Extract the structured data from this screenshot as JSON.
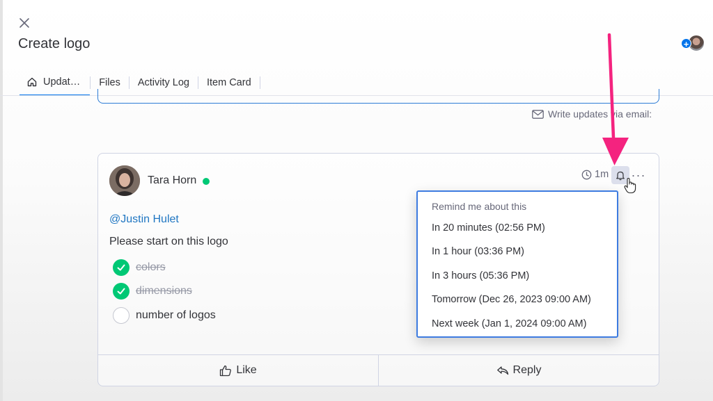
{
  "header": {
    "title": "Create logo",
    "close_icon": "close-icon",
    "add_subscriber_icon": "plus-icon"
  },
  "tabs": [
    {
      "label": "Updat…",
      "icon": "home-icon",
      "active": true
    },
    {
      "label": "Files"
    },
    {
      "label": "Activity Log"
    },
    {
      "label": "Item Card"
    }
  ],
  "email": {
    "label": "Write updates via email:",
    "icon": "mail-icon"
  },
  "update": {
    "author": "Tara Horn",
    "status": "online",
    "time_ago": "1m",
    "mention": "@Justin Hulet",
    "text": "Please start on this logo",
    "checklist": [
      {
        "text": "colors",
        "done": true
      },
      {
        "text": "dimensions",
        "done": true
      },
      {
        "text": "number of logos",
        "done": false
      }
    ],
    "actions": {
      "like": "Like",
      "reply": "Reply"
    }
  },
  "remind_menu": {
    "title": "Remind me about this",
    "items": [
      "In 20 minutes (02:56 PM)",
      "In 1 hour (03:36 PM)",
      "In 3 hours (05:36 PM)",
      "Tomorrow (Dec 26, 2023 09:00 AM)",
      "Next week (Jan 1, 2024 09:00 AM)"
    ]
  },
  "colors": {
    "accent": "#0073ea",
    "online": "#00c875",
    "mention": "#1f76c2",
    "annotation_arrow": "#f4237f",
    "highlight_box": "#3d7be0"
  }
}
